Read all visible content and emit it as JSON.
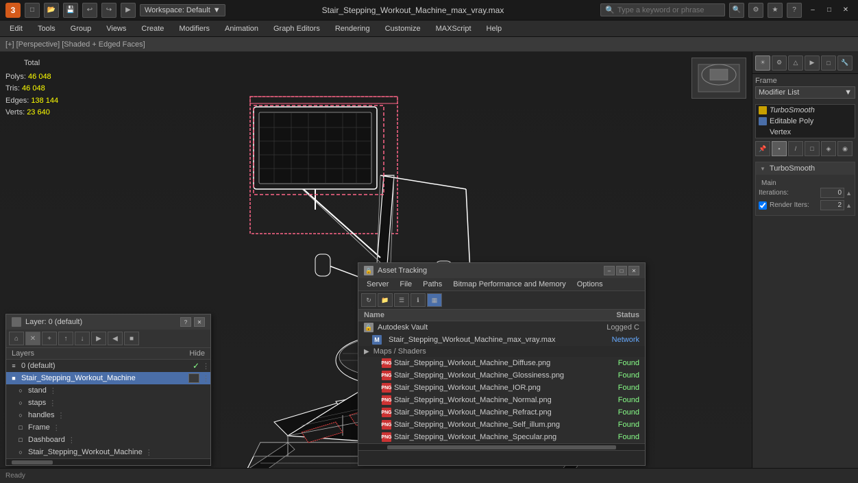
{
  "titlebar": {
    "app_logo": "3",
    "workspace": "Workspace: Default",
    "title": "Stair_Stepping_Workout_Machine_max_vray.max",
    "search_placeholder": "Type a keyword or phrase",
    "minimize": "–",
    "maximize": "□",
    "close": "✕"
  },
  "menubar": {
    "items": [
      "Edit",
      "Tools",
      "Group",
      "Views",
      "Create",
      "Modifiers",
      "Animation",
      "Graph Editors",
      "Rendering",
      "Customize",
      "MAXScript",
      "Help"
    ]
  },
  "viewport": {
    "label": "[+] [Perspective] [Shaded + Edged Faces]",
    "stats": {
      "header": "Total",
      "polys_label": "Polys:",
      "polys_value": "46 048",
      "tris_label": "Tris:",
      "tris_value": "46 048",
      "edges_label": "Edges:",
      "edges_value": "138 144",
      "verts_label": "Verts:",
      "verts_value": "23 640"
    }
  },
  "right_panel": {
    "frame_label": "Frame",
    "modifier_list_label": "Modifier List",
    "modifiers": [
      {
        "name": "TurboSmooth",
        "type": "yellow",
        "active": false
      },
      {
        "name": "Editable Poly",
        "type": "blue",
        "active": false
      },
      {
        "name": "Vertex",
        "type": "sub",
        "active": false
      }
    ],
    "turbosmooth": {
      "header": "TurboSmooth",
      "main_label": "Main",
      "iterations_label": "Iterations:",
      "iterations_value": "0",
      "render_iters_label": "Render Iters:",
      "render_iters_value": "2"
    }
  },
  "layers_panel": {
    "title": "Layer: 0 (default)",
    "hide_label": "Hide",
    "layers_label": "Layers",
    "items": [
      {
        "name": "0 (default)",
        "indent": 0,
        "checked": true
      },
      {
        "name": "Stair_Stepping_Workout_Machine",
        "indent": 0,
        "selected": true
      },
      {
        "name": "stand",
        "indent": 1
      },
      {
        "name": "staps",
        "indent": 1
      },
      {
        "name": "handles",
        "indent": 1
      },
      {
        "name": "Frame",
        "indent": 1
      },
      {
        "name": "Dashboard",
        "indent": 1
      },
      {
        "name": "Stair_Stepping_Workout_Machine",
        "indent": 1
      }
    ]
  },
  "asset_tracking": {
    "title": "Asset Tracking",
    "menus": [
      "Server",
      "File",
      "Paths",
      "Bitmap Performance and Memory",
      "Options"
    ],
    "table_headers": {
      "name": "Name",
      "status": "Status"
    },
    "rows": [
      {
        "name": "Autodesk Vault",
        "type": "vault",
        "status": "Logged C",
        "indent": 0
      },
      {
        "name": "Stair_Stepping_Workout_Machine_max_vray.max",
        "type": "max",
        "status": "Network",
        "indent": 1
      },
      {
        "name": "Maps / Shaders",
        "type": "group",
        "status": "",
        "indent": 1
      },
      {
        "name": "Stair_Stepping_Workout_Machine_Diffuse.png",
        "type": "png",
        "status": "Found",
        "indent": 2
      },
      {
        "name": "Stair_Stepping_Workout_Machine_Glossiness.png",
        "type": "png",
        "status": "Found",
        "indent": 2
      },
      {
        "name": "Stair_Stepping_Workout_Machine_IOR.png",
        "type": "png",
        "status": "Found",
        "indent": 2
      },
      {
        "name": "Stair_Stepping_Workout_Machine_Normal.png",
        "type": "png",
        "status": "Found",
        "indent": 2
      },
      {
        "name": "Stair_Stepping_Workout_Machine_Refract.png",
        "type": "png",
        "status": "Found",
        "indent": 2
      },
      {
        "name": "Stair_Stepping_Workout_Machine_Self_illum.png",
        "type": "png",
        "status": "Found",
        "indent": 2
      },
      {
        "name": "Stair_Stepping_Workout_Machine_Specular.png",
        "type": "png",
        "status": "Found",
        "indent": 2
      }
    ]
  }
}
